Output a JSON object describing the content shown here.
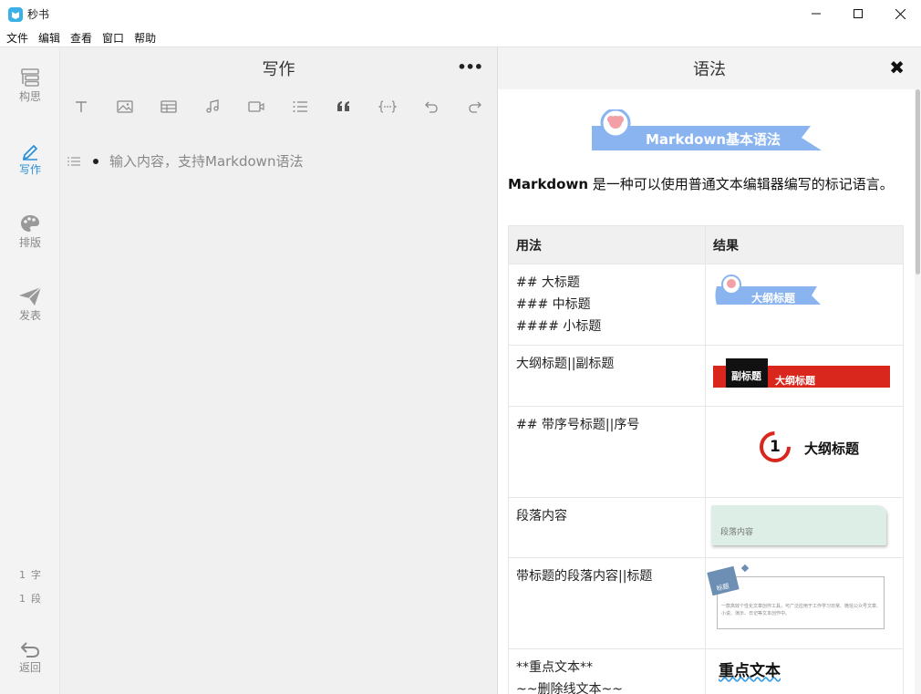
{
  "window": {
    "title": "秒书",
    "controls": {
      "minimize": "minimize",
      "maximize": "maximize",
      "close": "close"
    }
  },
  "menu": [
    "文件",
    "编辑",
    "查看",
    "窗口",
    "帮助"
  ],
  "sidebar": {
    "items": [
      {
        "label": "构思",
        "icon": "outline-icon"
      },
      {
        "label": "写作",
        "icon": "pen-icon",
        "active": true
      },
      {
        "label": "排版",
        "icon": "palette-icon"
      },
      {
        "label": "发表",
        "icon": "send-icon"
      }
    ],
    "word_count": {
      "value": "1",
      "unit": "字"
    },
    "paragraph_count": {
      "value": "1",
      "unit": "段"
    },
    "back_label": "返回"
  },
  "editor": {
    "title": "写作",
    "more": "•••",
    "toolbar": [
      "text-icon",
      "image-icon",
      "table-icon",
      "music-icon",
      "video-icon",
      "list-icon",
      "quote-icon",
      "code-icon",
      "undo-icon",
      "redo-icon"
    ],
    "placeholder": "输入内容，支持Markdown语法"
  },
  "panel": {
    "title": "语法",
    "close": "✖",
    "banner": "Markdown基本语法",
    "intro_bold": "Markdown",
    "intro_rest": " 是一种可以使用普通文本编辑器编写的标记语言。",
    "table": {
      "headers": [
        "用法",
        "结果"
      ],
      "rows": [
        {
          "usage": [
            "## 大标题",
            "### 中标题",
            "#### 小标题"
          ],
          "preview": "大纲标题"
        },
        {
          "usage": [
            "大纲标题||副标题"
          ],
          "preview": [
            "副标题",
            "大纲标题"
          ]
        },
        {
          "usage": [
            "## 带序号标题||序号"
          ],
          "preview": [
            "1",
            "大纲标题"
          ]
        },
        {
          "usage": [
            "段落内容"
          ],
          "preview": "段落内容"
        },
        {
          "usage": [
            "带标题的段落内容||标题"
          ],
          "preview": [
            "标题",
            "一款高效个性化文章创作工具，可广泛应用于工作学习日常、微信公众号文章、小说、演示、日记等文本创作中。"
          ]
        },
        {
          "usage": [
            "**重点文本**",
            "~~删除线文本~~"
          ],
          "preview": "重点文本"
        }
      ]
    }
  },
  "colors": {
    "accent": "#2b8fd6",
    "banner": "#8ab4f0",
    "red": "#d9271e"
  }
}
